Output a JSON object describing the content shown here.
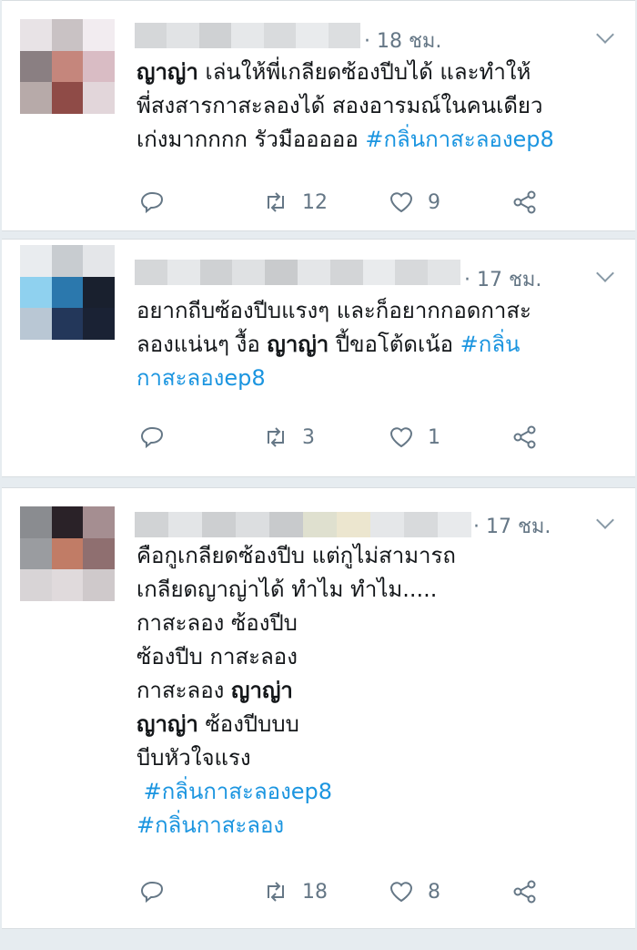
{
  "tweets": [
    {
      "time": "· 18 ชม.",
      "content": [
        {
          "type": "bold",
          "text": "ญาญ่า"
        },
        {
          "type": "text",
          "text": " เล่นให้พี่เกลียดซ้องปีบได้ และทำให้\nพี่สงสารกาสะลองได้ สองอารมณ์ในคนเดียว\nเก่งมากกกก รัวมือออออ "
        },
        {
          "type": "tag",
          "text": "#กลิ่นกาสะลองep8"
        }
      ],
      "retweets": "12",
      "likes": "9"
    },
    {
      "time": "· 17 ชม.",
      "content": [
        {
          "type": "text",
          "text": "อยากถีบซ้องปีบแรงๆ และก็อยากกอดกาสะ\nลองแน่นๆ งื้อ "
        },
        {
          "type": "bold",
          "text": "ญาญ่า"
        },
        {
          "type": "text",
          "text": " ปี้ขอโต้ดเน้อ "
        },
        {
          "type": "tag",
          "text": "#กลิ่น\nกาสะลองep8"
        }
      ],
      "retweets": "3",
      "likes": "1"
    },
    {
      "time": "· 17 ชม.",
      "content": [
        {
          "type": "text",
          "text": "คือกูเกลียดซ้องปีบ แต่กูไม่สามารถ\nเกลียดญาญ่าได้ ทำไม ทำไม.....\nกาสะลอง ซ้องปีบ\nซ้องปีบ กาสะลอง\nกาสะลอง "
        },
        {
          "type": "bold",
          "text": "ญาญ่า"
        },
        {
          "type": "text",
          "text": "\n"
        },
        {
          "type": "bold",
          "text": "ญาญ่า"
        },
        {
          "type": "text",
          "text": " ซ้องปีบบบ\nบีบหัวใจแรง\n "
        },
        {
          "type": "tag",
          "text": "#กลิ่นกาสะลองep8"
        },
        {
          "type": "text",
          "text": "\n"
        },
        {
          "type": "tag",
          "text": "#กลิ่นกาสะลอง"
        }
      ],
      "retweets": "18",
      "likes": "8"
    }
  ]
}
